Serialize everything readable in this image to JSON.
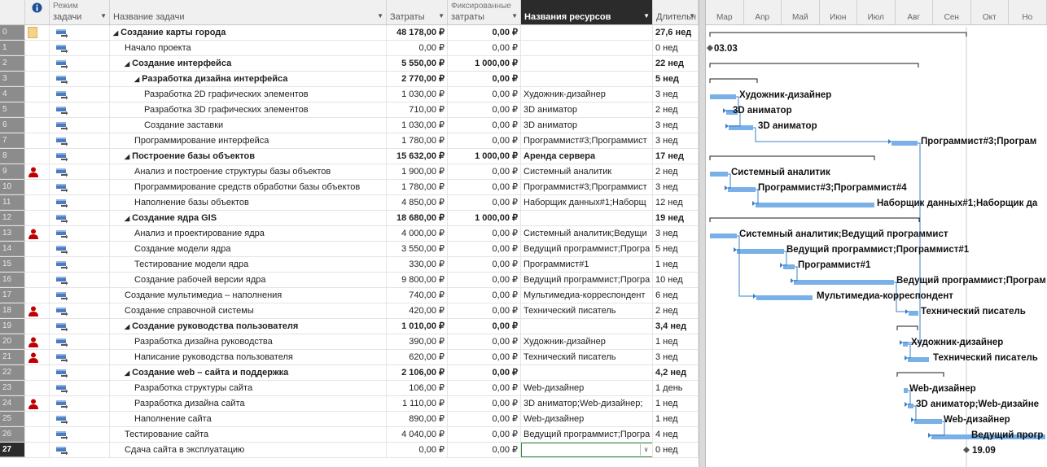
{
  "columns": {
    "indicators_icon": "info-icon",
    "mode": {
      "line1": "Режим",
      "line2": "задачи"
    },
    "name": "Название задачи",
    "cost": "Затраты",
    "fixed_cost": {
      "line1": "Фиксированные",
      "line2": "затраты"
    },
    "resources": "Названия ресурсов",
    "duration": "Длительн"
  },
  "timescale": {
    "months": [
      "Мар",
      "Апр",
      "Май",
      "Июн",
      "Июл",
      "Авг",
      "Сен",
      "Окт",
      "Но"
    ]
  },
  "rows": [
    {
      "id": "0",
      "name": "Создание карты города",
      "cost": "48 178,00 ₽",
      "fixed": "0,00 ₽",
      "resources": "",
      "duration": "27,6 нед",
      "summary": true,
      "level": 0,
      "indicator": "note"
    },
    {
      "id": "1",
      "name": "Начало проекта",
      "cost": "0,00 ₽",
      "fixed": "0,00 ₽",
      "resources": "",
      "duration": "0 нед",
      "summary": false,
      "level": 1,
      "indicator": ""
    },
    {
      "id": "2",
      "name": "Создание интерфейса",
      "cost": "5 550,00 ₽",
      "fixed": "1 000,00 ₽",
      "resources": "",
      "duration": "22 нед",
      "summary": true,
      "level": 1,
      "indicator": ""
    },
    {
      "id": "3",
      "name": "Разработка дизайна интерфейса",
      "cost": "2 770,00 ₽",
      "fixed": "0,00 ₽",
      "resources": "",
      "duration": "5 нед",
      "summary": true,
      "level": 2,
      "indicator": ""
    },
    {
      "id": "4",
      "name": "Разработка 2D графических элементов",
      "cost": "1 030,00 ₽",
      "fixed": "0,00 ₽",
      "resources": "Художник-дизайнер",
      "duration": "3 нед",
      "summary": false,
      "level": 3,
      "indicator": ""
    },
    {
      "id": "5",
      "name": "Разработка 3D графических элементов",
      "cost": "710,00 ₽",
      "fixed": "0,00 ₽",
      "resources": "3D аниматор",
      "duration": "2 нед",
      "summary": false,
      "level": 3,
      "indicator": ""
    },
    {
      "id": "6",
      "name": "Создание заставки",
      "cost": "1 030,00 ₽",
      "fixed": "0,00 ₽",
      "resources": "3D аниматор",
      "duration": "3 нед",
      "summary": false,
      "level": 3,
      "indicator": ""
    },
    {
      "id": "7",
      "name": "Программирование интерфейса",
      "cost": "1 780,00 ₽",
      "fixed": "0,00 ₽",
      "resources": "Программист#3;Программист",
      "duration": "3 нед",
      "summary": false,
      "level": 2,
      "indicator": ""
    },
    {
      "id": "8",
      "name": "Построение базы объектов",
      "cost": "15 632,00 ₽",
      "fixed": "1 000,00 ₽",
      "resources": "Аренда сервера",
      "duration": "17 нед",
      "summary": true,
      "level": 1,
      "indicator": ""
    },
    {
      "id": "9",
      "name": "Анализ и построение структуры базы объектов",
      "cost": "1 900,00 ₽",
      "fixed": "0,00 ₽",
      "resources": "Системный аналитик",
      "duration": "2 нед",
      "summary": false,
      "level": 2,
      "indicator": "person"
    },
    {
      "id": "10",
      "name": "Программирование средств обработки базы объектов",
      "cost": "1 780,00 ₽",
      "fixed": "0,00 ₽",
      "resources": "Программист#3;Программист",
      "duration": "3 нед",
      "summary": false,
      "level": 2,
      "indicator": ""
    },
    {
      "id": "11",
      "name": "Наполнение базы объектов",
      "cost": "4 850,00 ₽",
      "fixed": "0,00 ₽",
      "resources": "Наборщик данных#1;Наборщ",
      "duration": "12 нед",
      "summary": false,
      "level": 2,
      "indicator": ""
    },
    {
      "id": "12",
      "name": "Создание ядра GIS",
      "cost": "18 680,00 ₽",
      "fixed": "1 000,00 ₽",
      "resources": "",
      "duration": "19 нед",
      "summary": true,
      "level": 1,
      "indicator": ""
    },
    {
      "id": "13",
      "name": "Анализ и проектирование ядра",
      "cost": "4 000,00 ₽",
      "fixed": "0,00 ₽",
      "resources": "Системный аналитик;Ведущи",
      "duration": "3 нед",
      "summary": false,
      "level": 2,
      "indicator": "person"
    },
    {
      "id": "14",
      "name": "Создание модели ядра",
      "cost": "3 550,00 ₽",
      "fixed": "0,00 ₽",
      "resources": "Ведущий программист;Програ",
      "duration": "5 нед",
      "summary": false,
      "level": 2,
      "indicator": ""
    },
    {
      "id": "15",
      "name": "Тестирование модели ядра",
      "cost": "330,00 ₽",
      "fixed": "0,00 ₽",
      "resources": "Программист#1",
      "duration": "1 нед",
      "summary": false,
      "level": 2,
      "indicator": ""
    },
    {
      "id": "16",
      "name": "Создание рабочей версии ядра",
      "cost": "9 800,00 ₽",
      "fixed": "0,00 ₽",
      "resources": "Ведущий программист;Програ",
      "duration": "10 нед",
      "summary": false,
      "level": 2,
      "indicator": ""
    },
    {
      "id": "17",
      "name": "Создание мультимедиа – наполнения",
      "cost": "740,00 ₽",
      "fixed": "0,00 ₽",
      "resources": "Мультимедиа-корреспондент",
      "duration": "6 нед",
      "summary": false,
      "level": 1,
      "indicator": ""
    },
    {
      "id": "18",
      "name": "Создание справочной системы",
      "cost": "420,00 ₽",
      "fixed": "0,00 ₽",
      "resources": "Технический писатель",
      "duration": "2 нед",
      "summary": false,
      "level": 1,
      "indicator": "person"
    },
    {
      "id": "19",
      "name": "Создание руководства пользователя",
      "cost": "1 010,00 ₽",
      "fixed": "0,00 ₽",
      "resources": "",
      "duration": "3,4 нед",
      "summary": true,
      "level": 1,
      "indicator": ""
    },
    {
      "id": "20",
      "name": "Разработка дизайна руководства",
      "cost": "390,00 ₽",
      "fixed": "0,00 ₽",
      "resources": "Художник-дизайнер",
      "duration": "1 нед",
      "summary": false,
      "level": 2,
      "indicator": "person"
    },
    {
      "id": "21",
      "name": "Написание руководства пользователя",
      "cost": "620,00 ₽",
      "fixed": "0,00 ₽",
      "resources": "Технический писатель",
      "duration": "3 нед",
      "summary": false,
      "level": 2,
      "indicator": "person"
    },
    {
      "id": "22",
      "name": "Создание web – сайта и поддержка",
      "cost": "2 106,00 ₽",
      "fixed": "0,00 ₽",
      "resources": "",
      "duration": "4,2 нед",
      "summary": true,
      "level": 1,
      "indicator": ""
    },
    {
      "id": "23",
      "name": "Разработка структуры сайта",
      "cost": "106,00 ₽",
      "fixed": "0,00 ₽",
      "resources": "Web-дизайнер",
      "duration": "1 день",
      "summary": false,
      "level": 2,
      "indicator": ""
    },
    {
      "id": "24",
      "name": "Разработка дизайна сайта",
      "cost": "1 110,00 ₽",
      "fixed": "0,00 ₽",
      "resources": "3D аниматор;Web-дизайнер;",
      "duration": "1 нед",
      "summary": false,
      "level": 2,
      "indicator": "person"
    },
    {
      "id": "25",
      "name": "Наполнение сайта",
      "cost": "890,00 ₽",
      "fixed": "0,00 ₽",
      "resources": "Web-дизайнер",
      "duration": "1 нед",
      "summary": false,
      "level": 2,
      "indicator": ""
    },
    {
      "id": "26",
      "name": "Тестирование сайта",
      "cost": "4 040,00 ₽",
      "fixed": "0,00 ₽",
      "resources": "Ведущий программист;Програ",
      "duration": "4 нед",
      "summary": false,
      "level": 1,
      "indicator": ""
    },
    {
      "id": "27",
      "name": "Сдача сайта в эксплуатацию",
      "cost": "0,00 ₽",
      "fixed": "0,00 ₽",
      "resources": "",
      "duration": "0 нед",
      "summary": false,
      "level": 1,
      "indicator": "",
      "current": true
    }
  ],
  "gantt_labels": {
    "start_milestone": "03.03",
    "end_milestone": "19.09",
    "task_4": "Художник-дизайнер",
    "task_5": "3D аниматор",
    "task_6": "3D аниматор",
    "task_7": "Программист#3;Програм",
    "task_9": "Системный аналитик",
    "task_10": "Программист#3;Программист#4",
    "task_11": "Наборщик данных#1;Наборщик да",
    "task_13": "Системный аналитик;Ведущий программист",
    "task_14": "Ведущий программист;Программист#1",
    "task_15": "Программист#1",
    "task_16": "Ведущий программист;Програм",
    "task_17": "Мультимедиа-корреспондент",
    "task_18": "Технический писатель",
    "task_20": "Художник-дизайнер",
    "task_21": "Технический писатель",
    "task_23": "Web-дизайнер",
    "task_24": "3D аниматор;Web-дизайне",
    "task_25": "Web-дизайнер",
    "task_26": "Ведущий прогр"
  },
  "colors": {
    "bar": "#7ab0e8",
    "link": "#3a7fc8",
    "summary": "#1a1a1a",
    "row_header": "#8c8c8c",
    "selected_header": "#2b2b2b",
    "person_icon": "#c00000",
    "edit_border": "#2e8b3e"
  }
}
